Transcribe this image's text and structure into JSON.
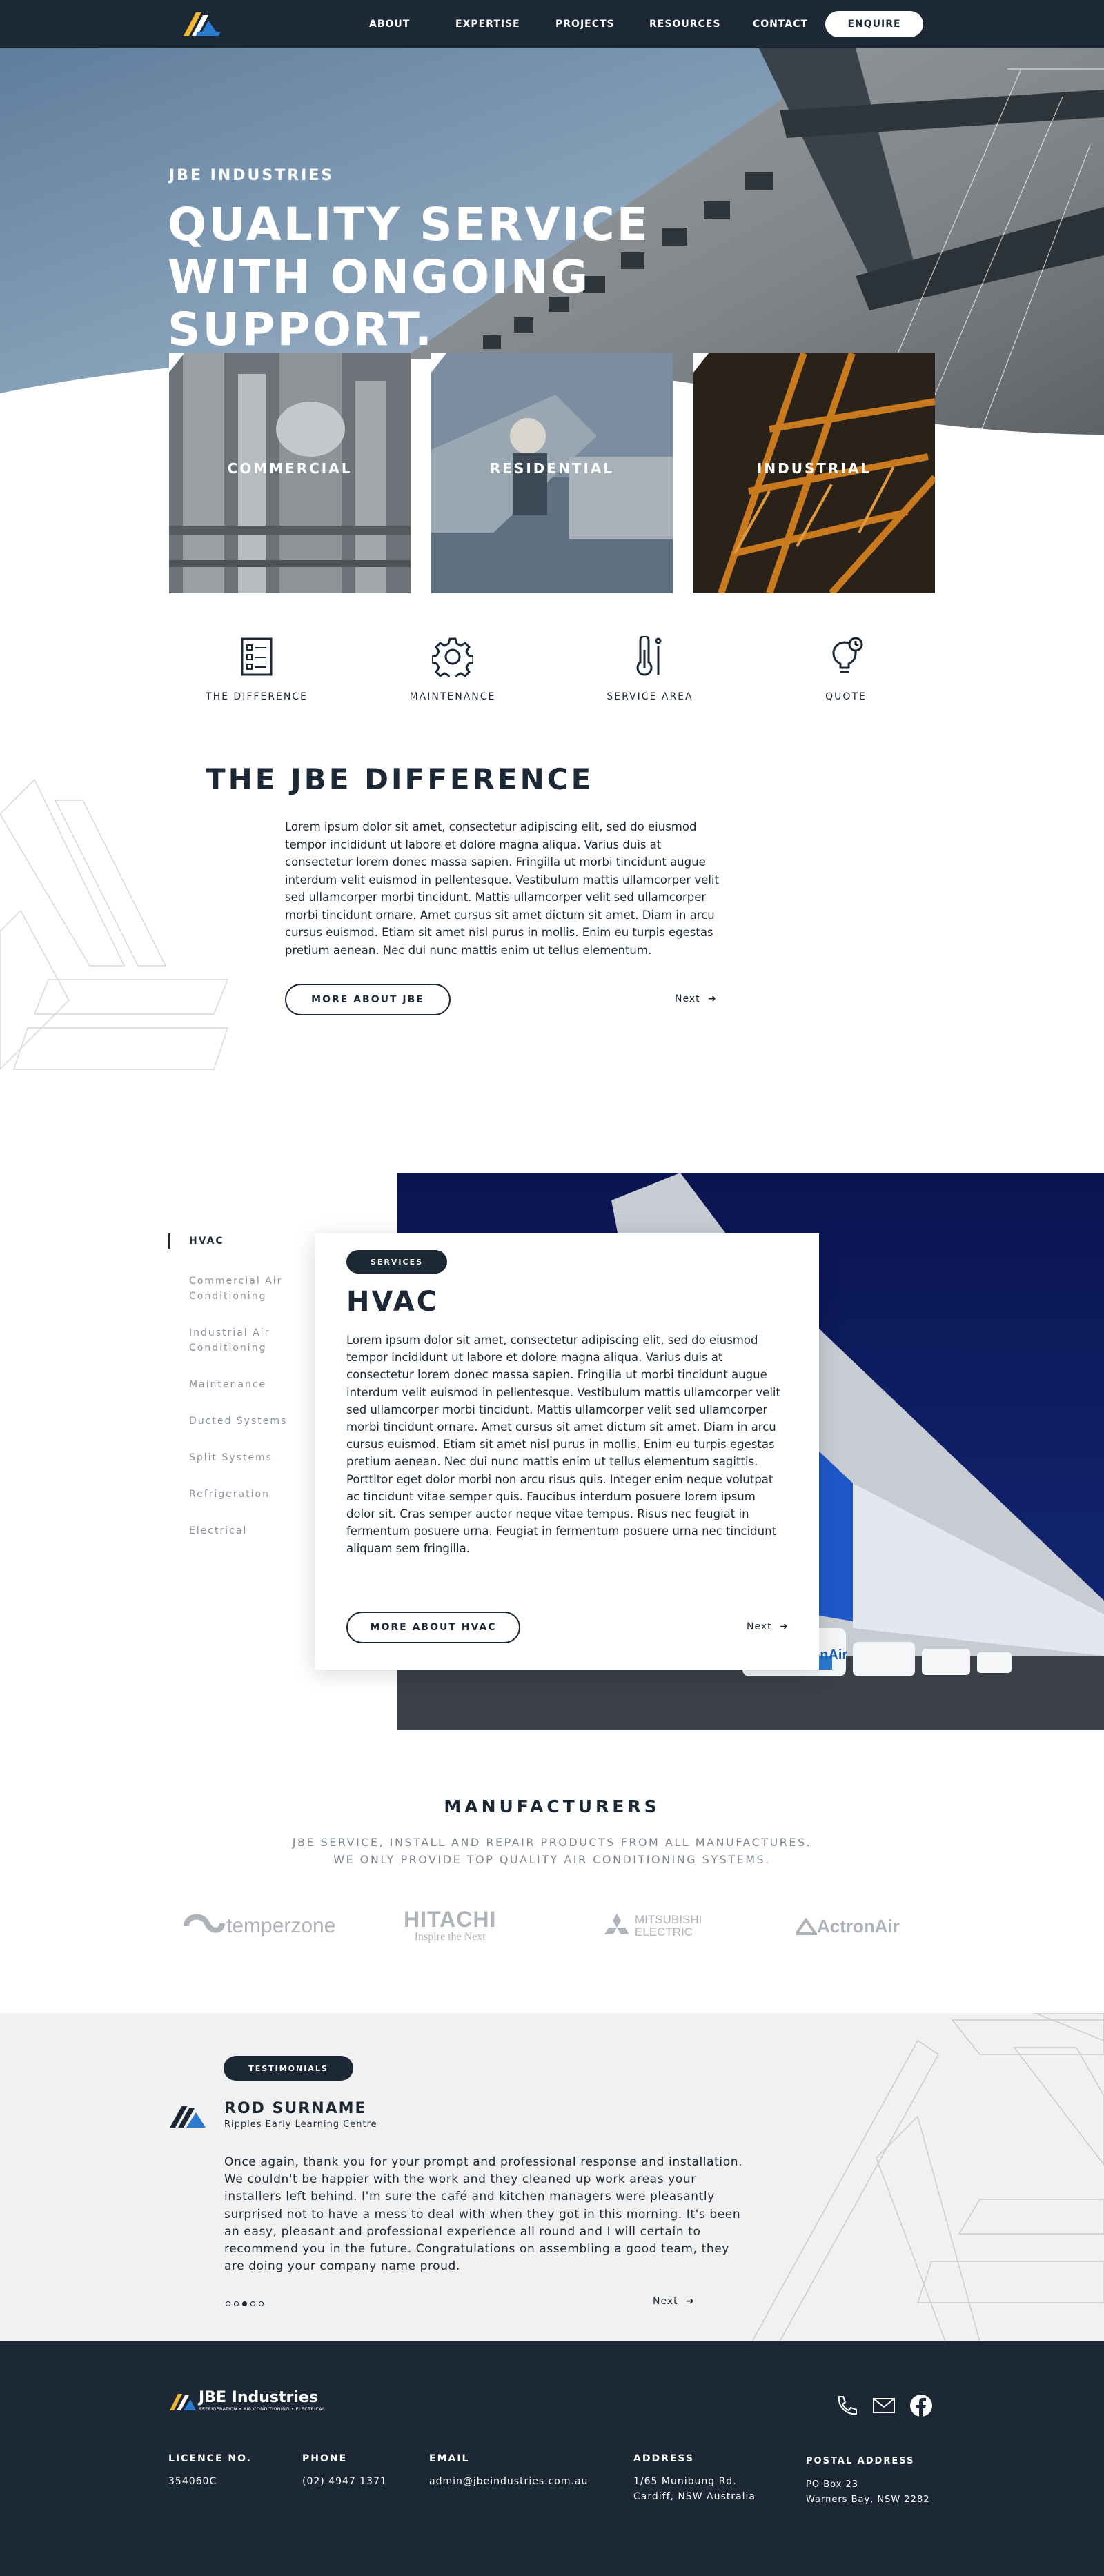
{
  "nav": {
    "logo_icon": "jbe-chevron-logo",
    "links": [
      "ABOUT",
      "EXPERTISE",
      "PROJECTS",
      "RESOURCES",
      "CONTACT"
    ],
    "enquire": "ENQUIRE"
  },
  "hero": {
    "eyebrow": "JBE INDUSTRIES",
    "title": "QUALITY SERVICE WITH ONGOING SUPPORT."
  },
  "categories": [
    "COMMERCIAL",
    "RESIDENTIAL",
    "INDUSTRIAL"
  ],
  "features": [
    {
      "label": "THE DIFFERENCE",
      "icon": "checklist-icon"
    },
    {
      "label": "MAINTENANCE",
      "icon": "gear-icon"
    },
    {
      "label": "SERVICE AREA",
      "icon": "thermometer-icon"
    },
    {
      "label": "QUOTE",
      "icon": "lightbulb-clock-icon"
    }
  ],
  "difference": {
    "title": "THE JBE DIFFERENCE",
    "text": "Lorem ipsum dolor sit amet, consectetur adipiscing elit, sed do eiusmod tempor incididunt ut labore et dolore magna aliqua. Varius duis at consectetur lorem donec massa sapien. Fringilla ut morbi tincidunt augue interdum velit euismod in pellentesque. Vestibulum mattis ullamcorper velit sed ullamcorper morbi tincidunt. Mattis ullamcorper velit sed ullamcorper morbi tincidunt ornare. Amet cursus sit amet dictum sit amet. Diam in arcu cursus euismod. Etiam sit amet nisl purus in mollis. Enim eu turpis egestas pretium aenean. Nec dui nunc mattis enim ut tellus elementum.",
    "button": "MORE ABOUT JBE",
    "next": "Next"
  },
  "services": {
    "menu": [
      "HVAC",
      "Commercial Air Conditioning",
      "Industrial Air Conditioning",
      "Maintenance",
      "Ducted Systems",
      "Split Systems",
      "Refrigeration",
      "Electrical"
    ],
    "pill": "SERVICES",
    "title": "HVAC",
    "text": "Lorem ipsum dolor sit amet, consectetur adipiscing elit, sed do eiusmod tempor incididunt ut labore et dolore magna aliqua. Varius duis at consectetur lorem donec massa sapien. Fringilla ut morbi tincidunt augue interdum velit euismod in pellentesque. Vestibulum mattis ullamcorper velit sed ullamcorper morbi tincidunt. Mattis ullamcorper velit sed ullamcorper morbi tincidunt ornare. Amet cursus sit amet dictum sit amet. Diam in arcu cursus euismod. Etiam sit amet nisl purus in mollis. Enim eu turpis egestas pretium aenean. Nec dui nunc mattis enim ut tellus elementum sagittis. Porttitor eget dolor morbi non arcu risus quis. Integer enim neque volutpat ac tincidunt vitae semper quis. Faucibus interdum posuere lorem ipsum dolor sit. Cras semper auctor neque vitae tempus. Risus nec feugiat in fermentum posuere urna. Feugiat in fermentum posuere urna nec tincidunt aliquam sem fringilla.",
    "button": "MORE ABOUT HVAC",
    "next": "Next",
    "van_brand": "ActronAir"
  },
  "manufacturers": {
    "title": "MANUFACTURERS",
    "subtitle_line1": "JBE SERVICE, INSTALL AND REPAIR PRODUCTS FROM ALL MANUFACTURES.",
    "subtitle_line2": "WE ONLY PROVIDE TOP QUALITY AIR CONDITIONING SYSTEMS.",
    "logos": {
      "temperzone": "temperzone",
      "hitachi": "HITACHI",
      "hitachi_tag": "Inspire the Next",
      "mitsubishi_1": "MITSUBISHI",
      "mitsubishi_2": "ELECTRIC",
      "actron": "ActronAir"
    }
  },
  "testimonials": {
    "pill": "TESTIMONIALS",
    "name": "ROD SURNAME",
    "org": "Ripples Early Learning Centre",
    "quote": "Once again, thank you for your prompt and professional response and installation. We couldn't be happier with the work and they cleaned up work areas your installers left behind. I'm sure the café and kitchen managers were pleasantly surprised not to have a mess to deal with when they got in this morning. It's been an easy, pleasant and professional experience all round and I will certain to recommend you in the future. Congratulations on assembling a good team, they are doing your company name proud.",
    "next": "Next",
    "active_dot": 3
  },
  "footer": {
    "brand": "JBE Industries",
    "brand_tag": "REFRIGERATION • AIR CONDITIONING • ELECTRICAL",
    "licence_label": "LICENCE NO.",
    "licence_value": "354060C",
    "phone_label": "PHONE",
    "phone_value": "(02) 4947 1371",
    "email_label": "EMAIL",
    "email_value": "admin@jbeindustries.com.au",
    "address_label": "ADDRESS",
    "address_line1": "1/65 Munibung Rd.",
    "address_line2": "Cardiff, NSW Australia",
    "postal_label": "POSTAL ADDRESS",
    "postal_line1": "PO Box 23",
    "postal_line2": "Warners Bay, NSW 2282",
    "social_icons": [
      "phone-icon",
      "mail-icon",
      "facebook-icon"
    ]
  },
  "colors": {
    "navy": "#1c2836",
    "accent_yellow": "#f2b632",
    "accent_blue": "#2b7bd0",
    "light_grey": "#f1f1f1"
  }
}
